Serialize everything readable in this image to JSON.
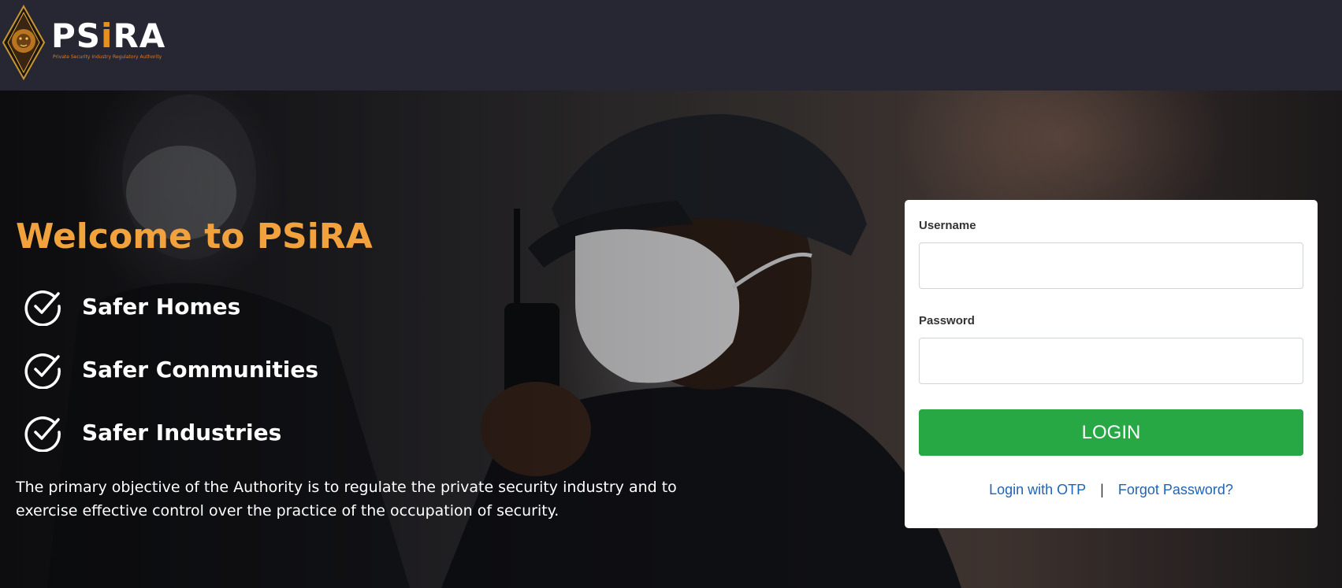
{
  "header": {
    "logo_text_main": "PS",
    "logo_text_accent": "i",
    "logo_text_end": "RA",
    "logo_tagline": "Private Security Industry Regulatory Authority"
  },
  "hero": {
    "welcome": "Welcome to PSiRA",
    "features": [
      {
        "label": "Safer Homes",
        "icon": "check-circle-icon"
      },
      {
        "label": "Safer Communities",
        "icon": "check-circle-icon"
      },
      {
        "label": "Safer Industries",
        "icon": "check-circle-icon"
      }
    ],
    "objective": "The primary objective of the Authority is to regulate the private security industry and to exercise effective control over the practice of the occupation of security."
  },
  "login": {
    "username_label": "Username",
    "username_value": "",
    "password_label": "Password",
    "password_value": "",
    "button_label": "LOGIN",
    "otp_link": "Login with OTP",
    "separator": "|",
    "forgot_link": "Forgot Password?"
  },
  "colors": {
    "topbar": "#272733",
    "accent_orange": "#f2a23c",
    "login_green": "#28a745",
    "link_blue": "#1f64b6"
  }
}
